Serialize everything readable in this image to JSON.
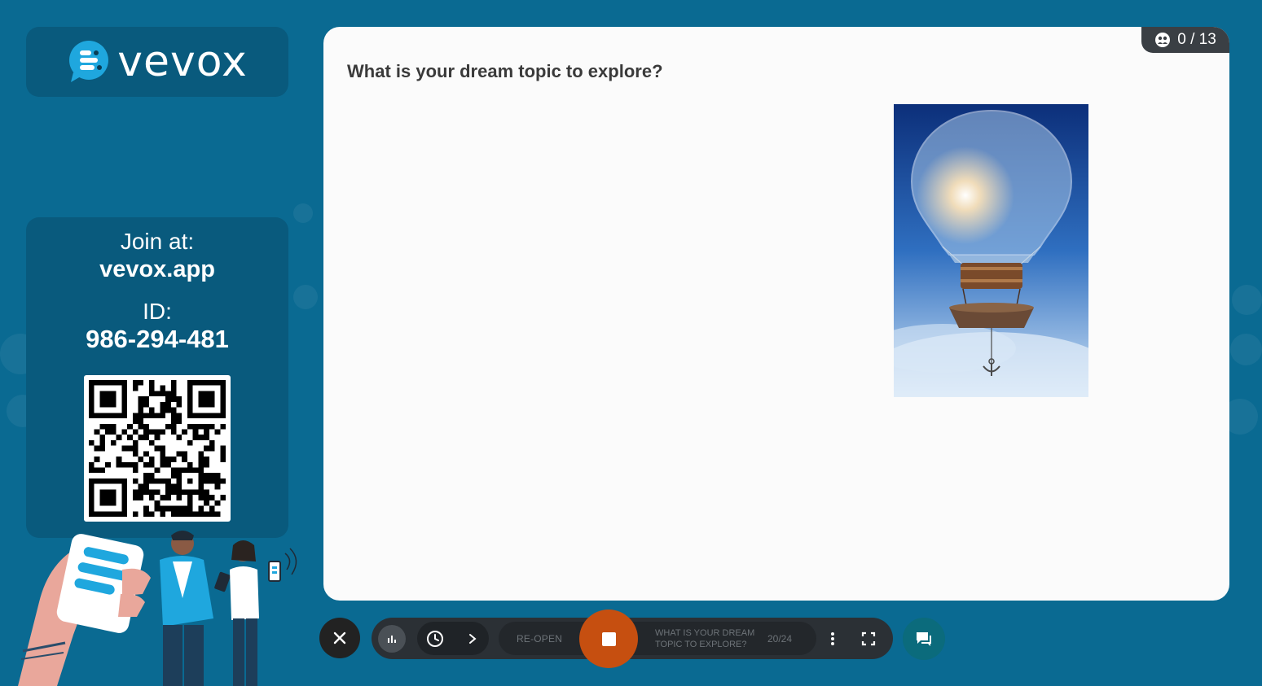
{
  "brand": {
    "name": "vevox"
  },
  "join": {
    "label": "Join at:",
    "url": "vevox.app",
    "id_label": "ID:",
    "id_value": "986-294-481"
  },
  "question": {
    "text": "What is your dream topic to explore?",
    "responses": "0 / 13"
  },
  "toolbar": {
    "close_icon": "close-icon",
    "reopen_label": "RE-OPEN",
    "poll_title": "WHAT IS YOUR DREAM TOPIC TO EXPLORE?",
    "progress": "20/24",
    "stop_color": "#c64f10"
  },
  "colors": {
    "background": "#0a6a92",
    "card": "#095a7d",
    "panel": "#fbfbfb",
    "accent": "#c64f10"
  }
}
